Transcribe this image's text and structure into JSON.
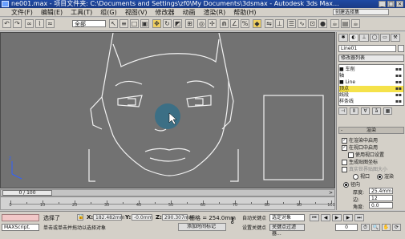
{
  "window": {
    "title": "ne001.max - 项目文件夹: C:\\Documents and Settings\\zf0\\My Documents\\3dsmax - Autodesk 3ds Max...",
    "buttons": [
      "_",
      "□",
      "×"
    ]
  },
  "menu": {
    "items": [
      "文件(F)",
      "编辑(E)",
      "工具(T)",
      "组(G)",
      "视图(V)",
      "修改器",
      "动画",
      "渲染(R)",
      "帮助(H)"
    ],
    "command_panel_dropdown": "创建选择集"
  },
  "toolbar": {
    "selection_filter": "全部"
  },
  "viewport": {
    "background": "#727272",
    "line_color": "#f2f2f2"
  },
  "timeslider": {
    "label": "0 / 100",
    "arrow": ">"
  },
  "trackbar": {
    "labels": [
      "0",
      "10",
      "20",
      "30",
      "40",
      "50",
      "60",
      "70",
      "80",
      "90",
      "100"
    ]
  },
  "status": {
    "selected": "选择了",
    "x_label": "X:",
    "x_value": "182.482mm",
    "y_label": "Y:",
    "y_value": "-0.0mm",
    "z_label": "Z:",
    "z_value": "290.307mm",
    "grid": "栅格 = 254.0mm",
    "prompt": "单击或单击并拖动以选择对象",
    "add_time_tag": "添加时间标记",
    "auto_key": "自动关键点",
    "set_key": "设置关键点",
    "key_mode_dropdown": "选定对象",
    "key_filters": "关键点过滤器...",
    "frame": "0",
    "script_label": "MAXScript."
  },
  "command_panel": {
    "object_name": "Line01",
    "modifier_list": "修改器列表",
    "stack": [
      {
        "label": "■ 车削",
        "highlight": false
      },
      {
        "label": "    轴",
        "highlight": false
      },
      {
        "label": "■ Line",
        "highlight": false
      },
      {
        "label": "    顶点",
        "highlight": true
      },
      {
        "label": "    线段",
        "highlight": false
      },
      {
        "label": "    样条线",
        "highlight": false
      }
    ],
    "rollout_title": "渲染",
    "checkboxes": [
      {
        "label": "在渲染中启用",
        "checked": true,
        "dim": false
      },
      {
        "label": "在视口中启用",
        "checked": true,
        "dim": false
      },
      {
        "label": "使用视口设置",
        "checked": false,
        "dim": false
      },
      {
        "label": "生成贴图坐标",
        "checked": false,
        "dim": false
      },
      {
        "label": "真实世界贴图大小",
        "checked": false,
        "dim": true
      }
    ],
    "viewport_radio": "视口",
    "render_radio": "渲染",
    "radial_radio": "径向",
    "thickness_label": "厚度:",
    "thickness_value": "25.4mm",
    "sides_label": "边:",
    "sides_value": "12",
    "angle_label": "角度:",
    "angle_value": "0.0",
    "rect_radio": "矩形"
  }
}
